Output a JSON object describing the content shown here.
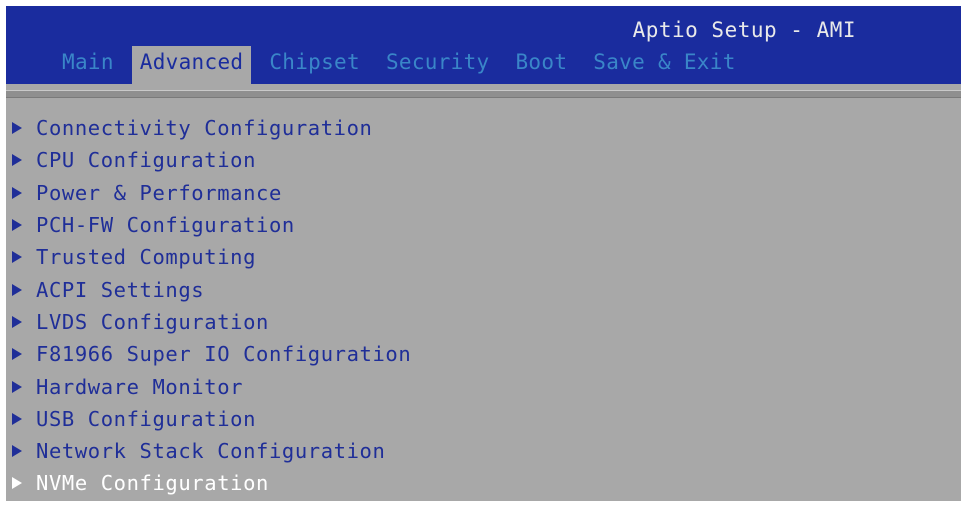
{
  "app_title": "Aptio Setup - AMI",
  "tabs": [
    {
      "label": "Main",
      "active": false
    },
    {
      "label": "Advanced",
      "active": true
    },
    {
      "label": "Chipset",
      "active": false
    },
    {
      "label": "Security",
      "active": false
    },
    {
      "label": "Boot",
      "active": false
    },
    {
      "label": "Save & Exit",
      "active": false
    }
  ],
  "menu": [
    {
      "label": "Connectivity Configuration",
      "selected": false
    },
    {
      "label": "CPU Configuration",
      "selected": false
    },
    {
      "label": "Power & Performance",
      "selected": false
    },
    {
      "label": "PCH-FW Configuration",
      "selected": false
    },
    {
      "label": "Trusted Computing",
      "selected": false
    },
    {
      "label": "ACPI Settings",
      "selected": false
    },
    {
      "label": "LVDS Configuration",
      "selected": false
    },
    {
      "label": "F81966 Super IO Configuration",
      "selected": false
    },
    {
      "label": "Hardware Monitor",
      "selected": false
    },
    {
      "label": "USB Configuration",
      "selected": false
    },
    {
      "label": "Network Stack Configuration",
      "selected": false
    },
    {
      "label": "NVMe Configuration",
      "selected": true
    }
  ],
  "colors": {
    "header_bg": "#1a2c9e",
    "body_bg": "#a8a8a8",
    "tab_inactive": "#3a86c8",
    "item_text": "#1f2e98",
    "selected_text": "#ffffff"
  }
}
